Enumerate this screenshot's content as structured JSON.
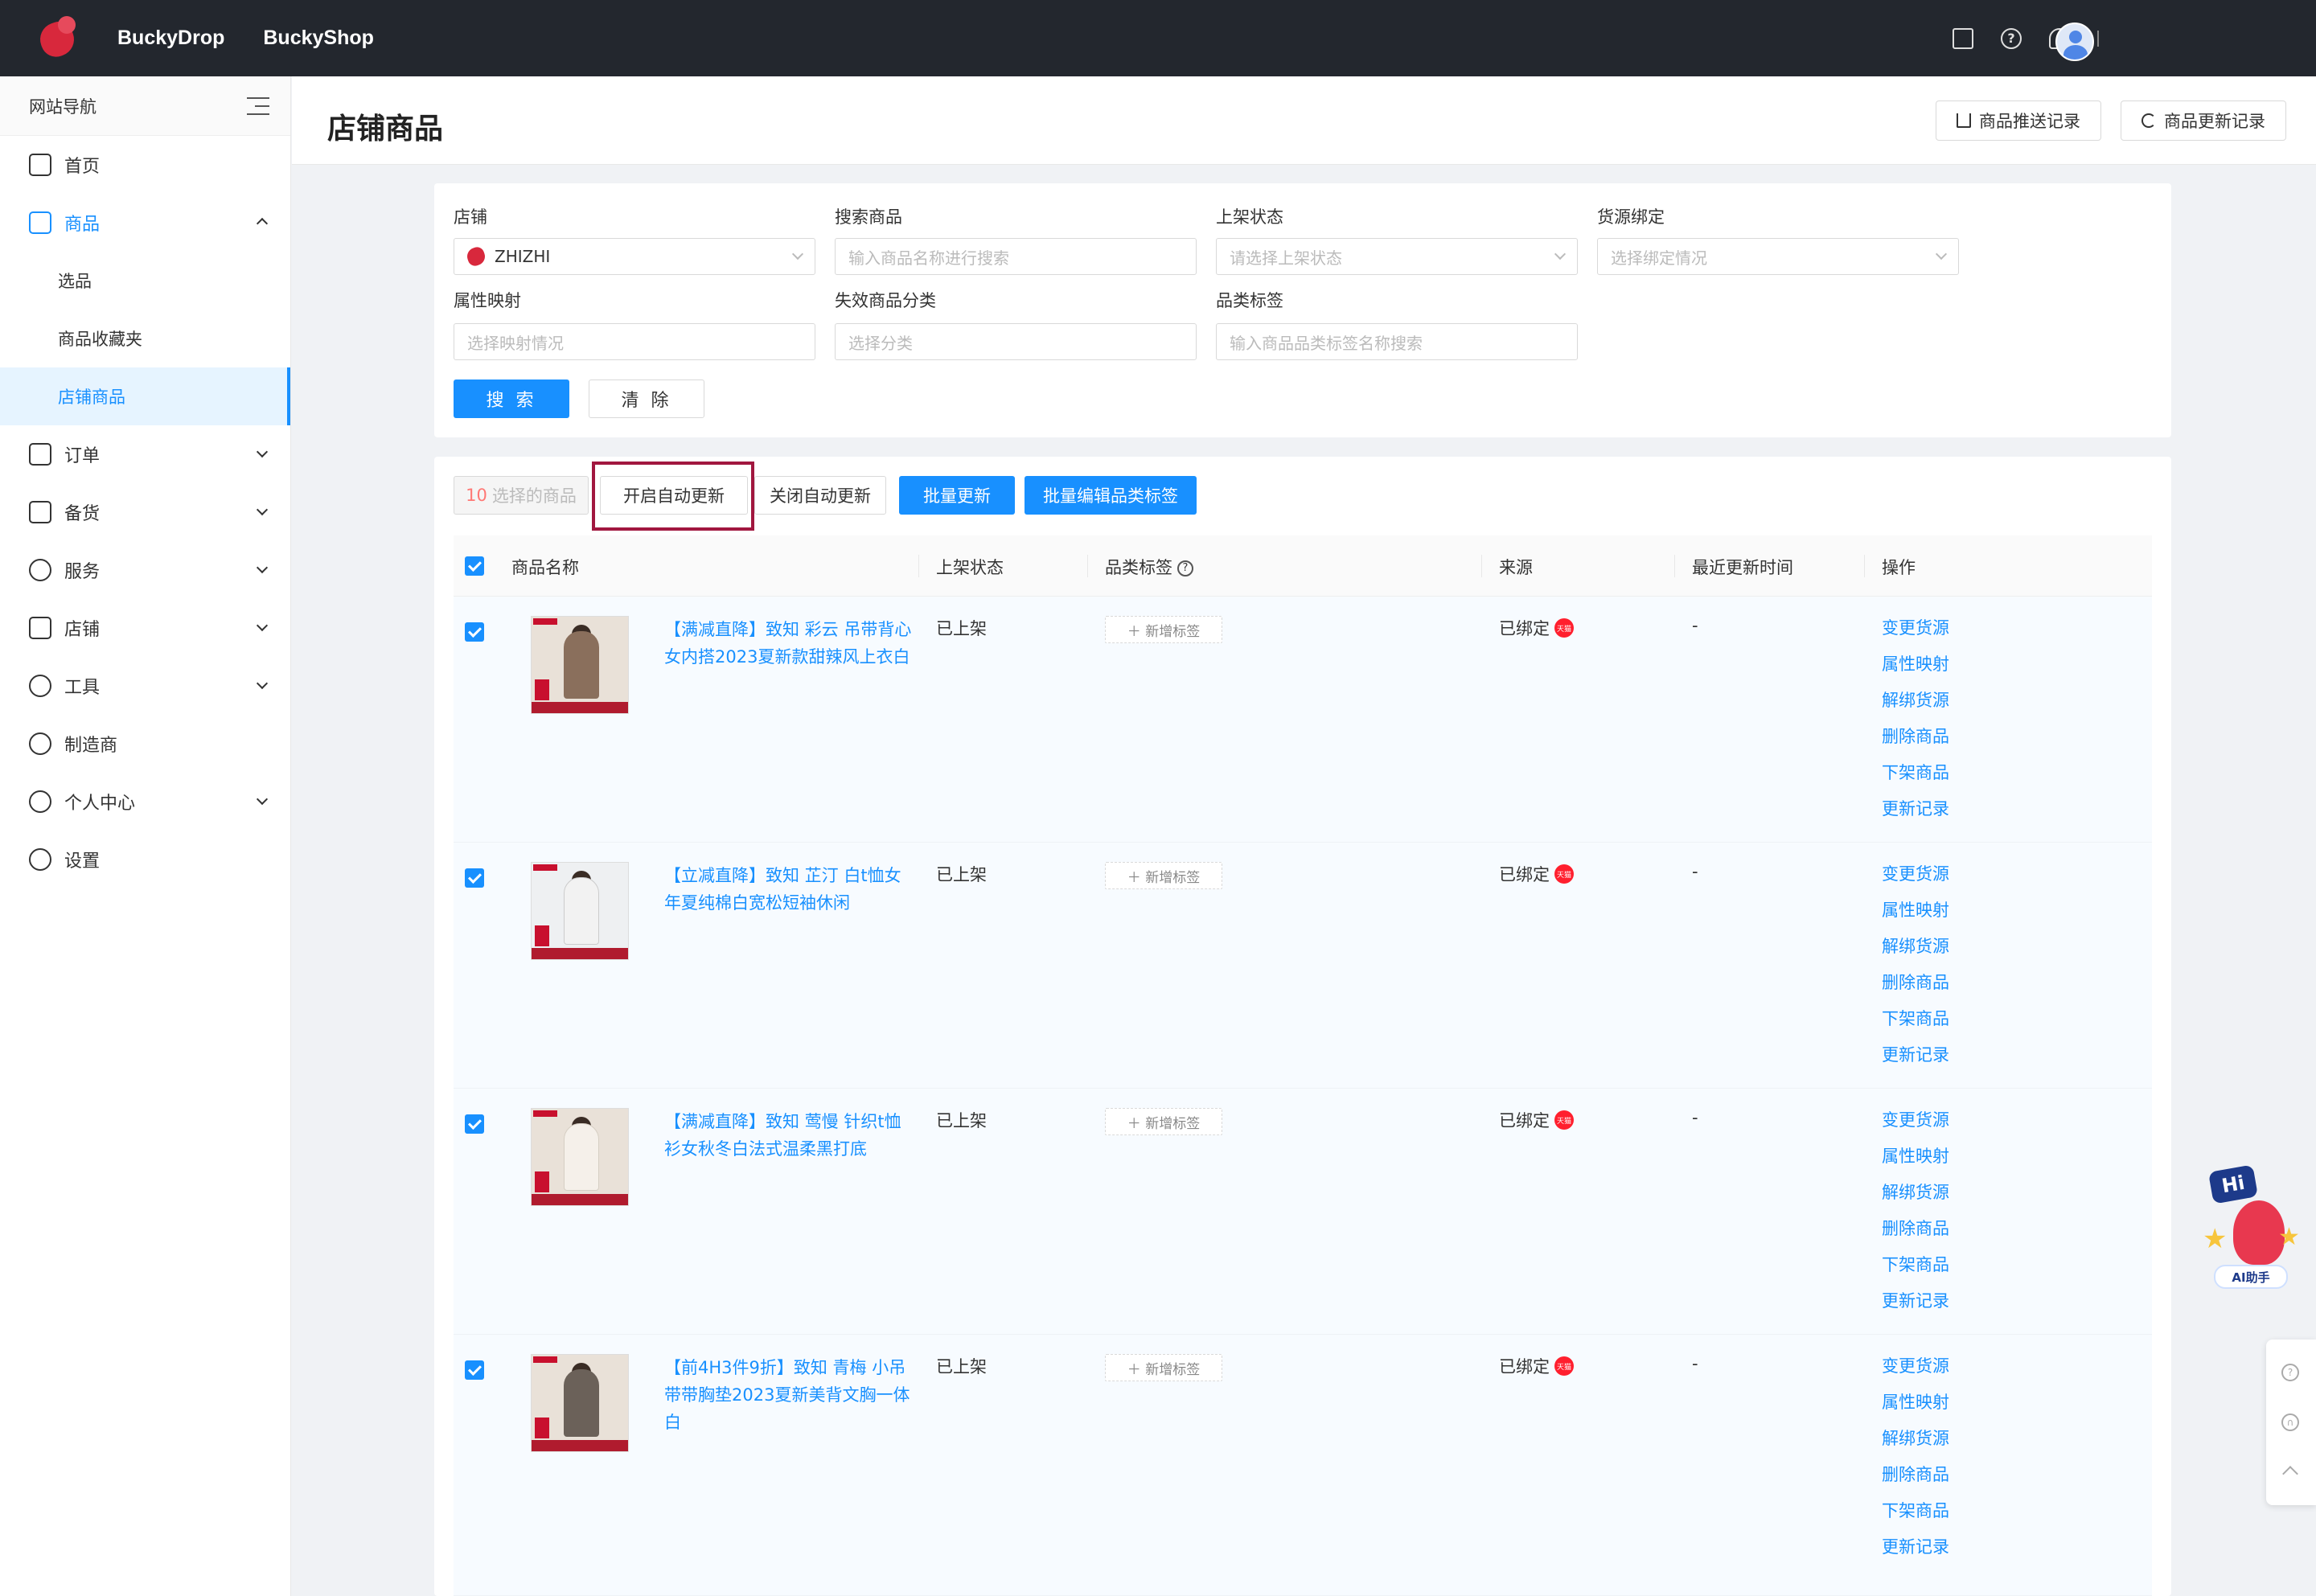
{
  "header": {
    "brands": [
      "BuckyDrop",
      "BuckyShop"
    ],
    "icons": [
      "document-icon",
      "help-icon",
      "bell-icon"
    ]
  },
  "sidebar": {
    "title": "网站导航",
    "items": [
      {
        "label": "首页",
        "icon": "home-icon"
      },
      {
        "label": "商品",
        "icon": "bag-icon",
        "expanded": true,
        "children": [
          "选品",
          "商品收藏夹",
          "店铺商品"
        ]
      },
      {
        "label": "订单",
        "icon": "order-icon"
      },
      {
        "label": "备货",
        "icon": "box-icon"
      },
      {
        "label": "服务",
        "icon": "service-icon"
      },
      {
        "label": "店铺",
        "icon": "store-icon"
      },
      {
        "label": "工具",
        "icon": "wrench-icon"
      },
      {
        "label": "制造商",
        "icon": "factory-icon"
      },
      {
        "label": "个人中心",
        "icon": "user-icon"
      },
      {
        "label": "设置",
        "icon": "gear-icon"
      }
    ],
    "selected_child": "店铺商品"
  },
  "page": {
    "title": "店铺商品",
    "push_record": "商品推送记录",
    "update_record": "商品更新记录"
  },
  "filters": {
    "shop_label": "店铺",
    "shop_value": "ZHIZHI",
    "search_label": "搜索商品",
    "search_placeholder": "输入商品名称进行搜索",
    "listing_label": "上架状态",
    "listing_placeholder": "请选择上架状态",
    "supply_label": "货源绑定",
    "supply_placeholder": "选择绑定情况",
    "attr_label": "属性映射",
    "attr_placeholder": "选择映射情况",
    "invalid_label": "失效商品分类",
    "invalid_placeholder": "选择分类",
    "category_label": "品类标签",
    "category_placeholder": "输入商品品类标签名称搜索",
    "search_button": "搜 索",
    "clear_button": "清 除"
  },
  "toolbar": {
    "selected_count": "10",
    "selected_text": "选择的商品",
    "enable_auto": "开启自动更新",
    "disable_auto": "关闭自动更新",
    "batch_update": "批量更新",
    "batch_edit_tags": "批量编辑品类标签"
  },
  "table": {
    "columns": [
      "商品名称",
      "上架状态",
      "品类标签",
      "来源",
      "最近更新时间",
      "操作"
    ],
    "add_tag": "新增标签",
    "tmall_badge": "天猫",
    "actions": [
      "变更货源",
      "属性映射",
      "解绑货源",
      "删除商品",
      "下架商品",
      "更新记录"
    ],
    "rows": [
      {
        "name": "【满减直降】致知 彩云 吊带背心女内搭2023夏新款甜辣风上衣白",
        "status": "已上架",
        "source": "已绑定",
        "updated": "-"
      },
      {
        "name": "【立减直降】致知 芷汀 白t恤女年夏纯棉白宽松短袖休闲",
        "status": "已上架",
        "source": "已绑定",
        "updated": "-"
      },
      {
        "name": "【满减直降】致知 莺慢 针织t恤衫女秋冬白法式温柔黑打底",
        "status": "已上架",
        "source": "已绑定",
        "updated": "-"
      },
      {
        "name": "【前4H3件9折】致知 青梅 小吊带带胸垫2023夏新美背文胸一体白",
        "status": "已上架",
        "source": "已绑定",
        "updated": "-"
      }
    ]
  },
  "ai_assistant": {
    "label": "AI助手",
    "bubble": "Hi"
  }
}
